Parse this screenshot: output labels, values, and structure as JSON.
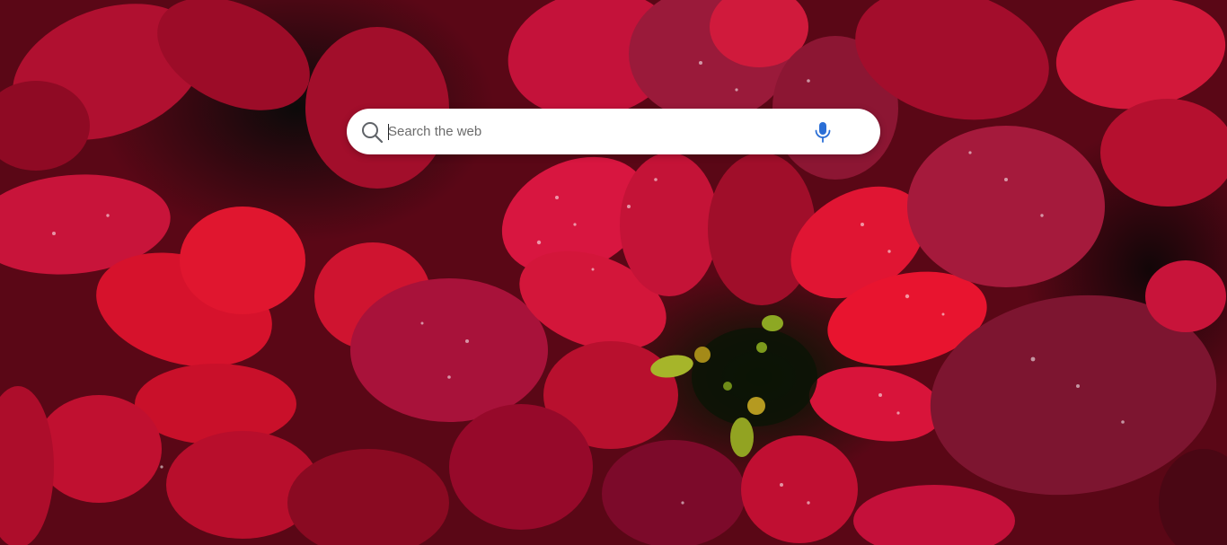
{
  "background": {
    "subject": "poinsettia-photo",
    "colors": {
      "deep": "#5a0716",
      "crimson": "#b3102a",
      "bright": "#e0142f",
      "center": "#0a1505",
      "bud": "#8a9a1a"
    }
  },
  "search": {
    "placeholder": "Search the web",
    "value": "",
    "search_icon": "search-icon",
    "mic_icon": "microphone-icon",
    "accent": "#2b6fd6"
  }
}
